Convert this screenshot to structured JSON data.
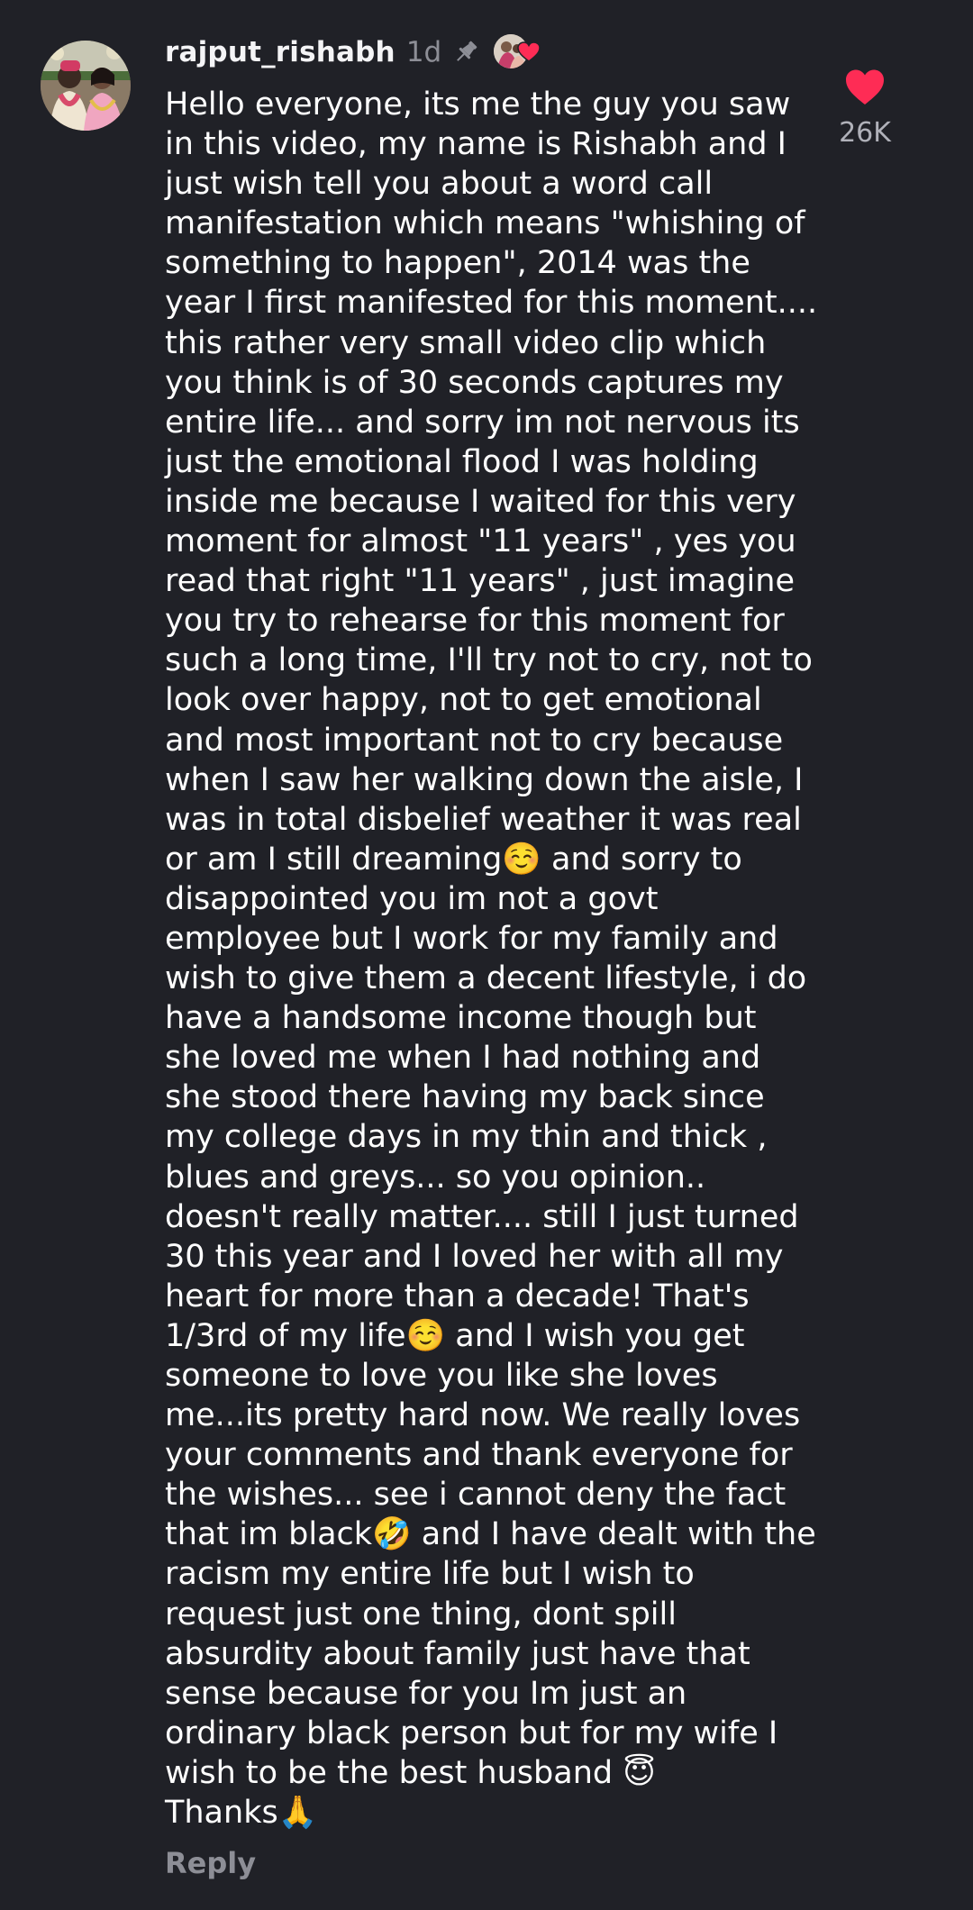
{
  "comment": {
    "username": "rajput_rishabh",
    "time": "1d",
    "text_lines": [
      "Hello everyone, its me the guy you saw",
      "in this video, my name is Rishabh and I",
      "just wish tell you about a word call",
      "manifestation which means \"whishing of",
      "something to happen\", 2014 was the",
      "year I first manifested for this moment....",
      "this rather very small video clip which",
      "you think is of 30 seconds captures my",
      "entire life... and sorry im not nervous its",
      "just the emotional flood I was holding",
      "inside me because I waited for this very",
      "moment for almost \"11 years\" , yes you",
      "read that right \"11 years\" , just imagine",
      "you try to rehearse for this moment for",
      "such a long time, I'll try not to cry, not to",
      "look over happy, not to get emotional",
      "and most important not to cry because",
      "when I saw her walking down the aisle, I",
      "was in total disbelief weather it was real",
      "or am I still dreaming☺️ and sorry to",
      "disappointed you im not a govt",
      "employee but I work for my family and",
      "wish to give them a decent lifestyle, i do",
      "have a handsome income though but",
      "she loved me when I had nothing and",
      "she stood there having my back since",
      "my college days in my thin and thick ,",
      "blues and greys... so you opinion..",
      "doesn't really matter.... still I just turned",
      "30 this year and I loved her with all my",
      "heart for more than a decade! That's",
      "1/3rd of my life☺️ and I wish you get",
      "someone to love you like she loves",
      "me...its pretty hard now. We really loves",
      "your comments and thank everyone for",
      "the wishes... see i cannot deny the fact",
      "that im black🤣 and I have dealt with the",
      "racism my entire life but I wish to",
      "request just one thing, dont spill",
      "absurdity about family just have that",
      "sense because for you Im just an",
      "ordinary black person but for my wife I",
      "wish to be the best husband 😇",
      "Thanks🙏"
    ],
    "like_count": "26K",
    "reply_label": "Reply"
  },
  "colors": {
    "background": "#202127",
    "text": "#ffffff",
    "muted": "#8d8e96",
    "heart": "#fe2c55"
  },
  "icons": {
    "pin": "pin-icon",
    "like": "heart-icon",
    "creator_liked": "creator-liked-badge"
  }
}
